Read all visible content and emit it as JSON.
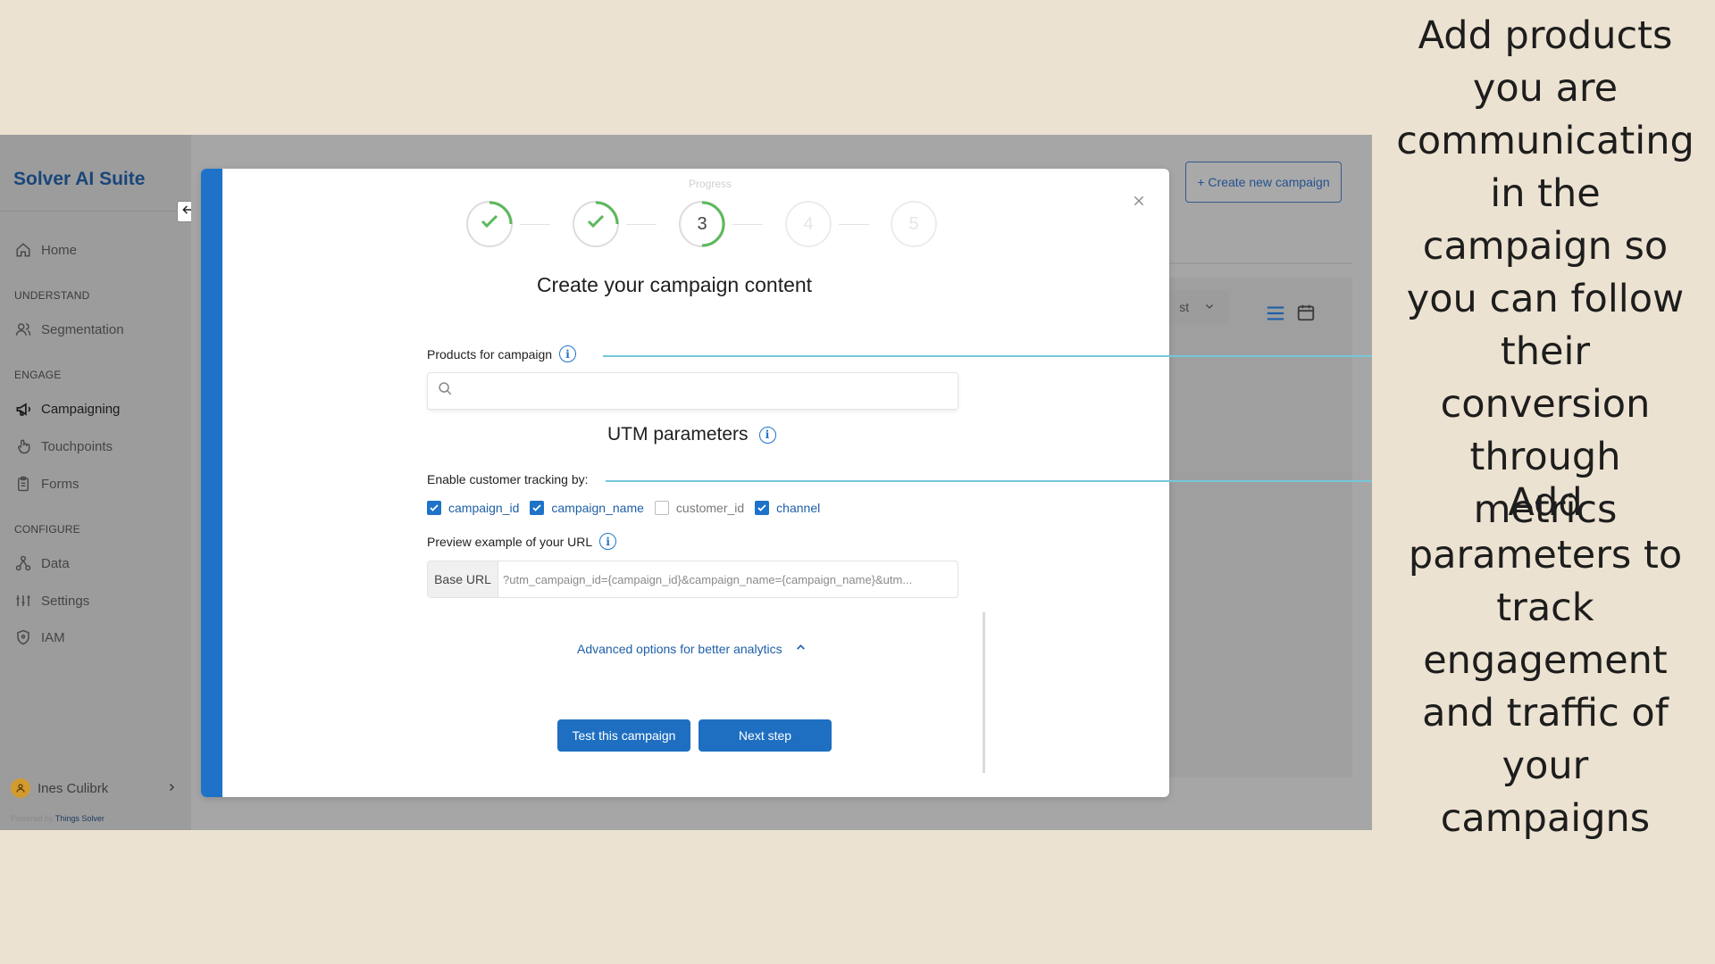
{
  "sidebar": {
    "brand": "Solver AI Suite",
    "items": [
      {
        "label": "Home",
        "icon": "home-icon"
      },
      {
        "section": "UNDERSTAND"
      },
      {
        "label": "Segmentation",
        "icon": "users-icon"
      },
      {
        "section": "ENGAGE"
      },
      {
        "label": "Campaigning",
        "icon": "megaphone-icon",
        "active": true
      },
      {
        "label": "Touchpoints",
        "icon": "touch-icon"
      },
      {
        "label": "Forms",
        "icon": "clipboard-icon"
      },
      {
        "section": "CONFIGURE"
      },
      {
        "label": "Data",
        "icon": "data-icon"
      },
      {
        "label": "Settings",
        "icon": "sliders-icon"
      },
      {
        "label": "IAM",
        "icon": "shield-icon"
      }
    ],
    "user": {
      "name": "Ines Culibrk"
    },
    "powered_by": "Powered by",
    "powered_by_company": "Things Solver"
  },
  "main": {
    "create_button": "+ Create new campaign",
    "sort_label": "st"
  },
  "modal": {
    "progress_label": "Progress",
    "steps": [
      {
        "number": "1",
        "state": "done"
      },
      {
        "number": "2",
        "state": "done"
      },
      {
        "number": "3",
        "state": "current"
      },
      {
        "number": "4",
        "state": "todo"
      },
      {
        "number": "5",
        "state": "todo"
      }
    ],
    "title": "Create your campaign content",
    "products_label": "Products for campaign",
    "products_placeholder": "",
    "utm_title": "UTM parameters",
    "tracking_label": "Enable customer tracking by:",
    "tracking_options": [
      {
        "label": "campaign_id",
        "checked": true
      },
      {
        "label": "campaign_name",
        "checked": true
      },
      {
        "label": "customer_id",
        "checked": false
      },
      {
        "label": "channel",
        "checked": true
      }
    ],
    "preview_label": "Preview example of your URL",
    "url_prefix": "Base URL",
    "url_value": "?utm_campaign_id={campaign_id}&campaign_name={campaign_name}&utm...",
    "advanced_label": "Advanced options for better analytics",
    "test_button": "Test this campaign",
    "next_button": "Next step"
  },
  "annotations": {
    "products_note": "Add products you are communicating in the campaign so you can follow their conversion through metrics",
    "utm_note": "Add parameters to track engagement and traffic of your campaigns"
  },
  "colors": {
    "accent": "#1e73c8",
    "progress_green": "#5cb85c",
    "background": "#ece2d1",
    "connector": "#74c7da"
  }
}
